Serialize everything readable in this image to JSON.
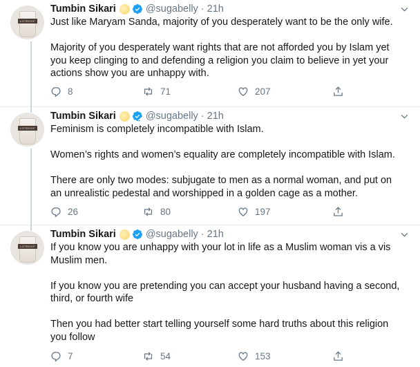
{
  "tweets": [
    {
      "author": "Tumbin Sikari",
      "handle": "@sugabelly",
      "separator": "·",
      "time": "21h",
      "paragraphs": [
        "Just like Maryam Sanda, majority of you desperately want to be the only wife.",
        "Majority of you desperately want rights that are not afforded you by Islam yet you keep clinging to and defending a religion you claim to believe in yet your actions show you are unhappy with."
      ],
      "replies": "8",
      "retweets": "71",
      "likes": "207"
    },
    {
      "author": "Tumbin Sikari",
      "handle": "@sugabelly",
      "separator": "·",
      "time": "21h",
      "paragraphs": [
        "Feminism is completely incompatible with Islam.",
        "Women’s rights and women’s equality are completely incompatible with Islam.",
        "There are only two modes: subjugate to men as a normal woman, and put on an unrealistic pedestal and worshipped in a golden cage as a mother."
      ],
      "replies": "26",
      "retweets": "80",
      "likes": "197"
    },
    {
      "author": "Tumbin Sikari",
      "handle": "@sugabelly",
      "separator": "·",
      "time": "21h",
      "paragraphs": [
        "If you know you are unhappy with your lot in life as a Muslim woman vis a vis Muslim men.",
        "If you know you are pretending you can accept your husband having a second, third, or fourth wife",
        "Then you had better start telling yourself some hard truths about this religion you follow"
      ],
      "replies": "7",
      "retweets": "54",
      "likes": "153"
    }
  ],
  "avatar_cup_text": "LOTEHOF",
  "icons": {
    "reply": "reply-icon",
    "retweet": "retweet-icon",
    "like": "heart-icon",
    "share": "share-icon",
    "verified": "verified-badge-icon",
    "caret": "chevron-down-icon",
    "emoji": "smiling-face-emoji-icon"
  },
  "colors": {
    "verified": "#1da1f2",
    "secondary_text": "#657786",
    "divider": "#e6ecf0",
    "thread_line": "#ccd6dd"
  }
}
